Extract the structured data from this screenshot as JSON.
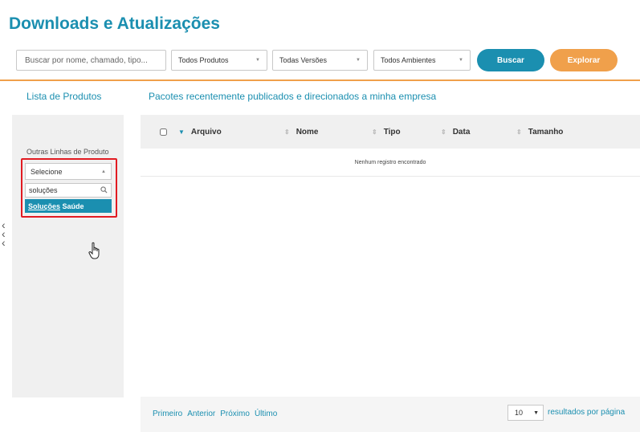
{
  "header": {
    "title": "Downloads e Atualizações"
  },
  "filters": {
    "search_placeholder": "Buscar por nome, chamado, tipo...",
    "produtos": "Todos Produtos",
    "versoes": "Todas Versões",
    "ambientes": "Todos Ambientes",
    "buscar_label": "Buscar",
    "explorar_label": "Explorar"
  },
  "sidebar": {
    "title": "Lista de Produtos",
    "outras_label": "Outras Linhas de Produto",
    "dropdown": {
      "selected": "Selecione",
      "search_value": "soluções",
      "option_highlight": "Soluções",
      "option_rest": " Saúde"
    }
  },
  "main": {
    "title": "Pacotes recentemente publicados e direcionados a minha empresa",
    "columns": [
      "Arquivo",
      "Nome",
      "Tipo",
      "Data",
      "Tamanho"
    ],
    "empty_message": "Nenhum registro encontrado"
  },
  "pagination": {
    "first": "Primeiro",
    "previous": "Anterior",
    "next": "Próximo",
    "last": "Último",
    "page_size": "10",
    "per_page_label": "resultados por página"
  },
  "colors": {
    "brand_blue": "#1b8fb0",
    "brand_orange": "#f0a04b",
    "highlight_red": "#e11b22"
  }
}
